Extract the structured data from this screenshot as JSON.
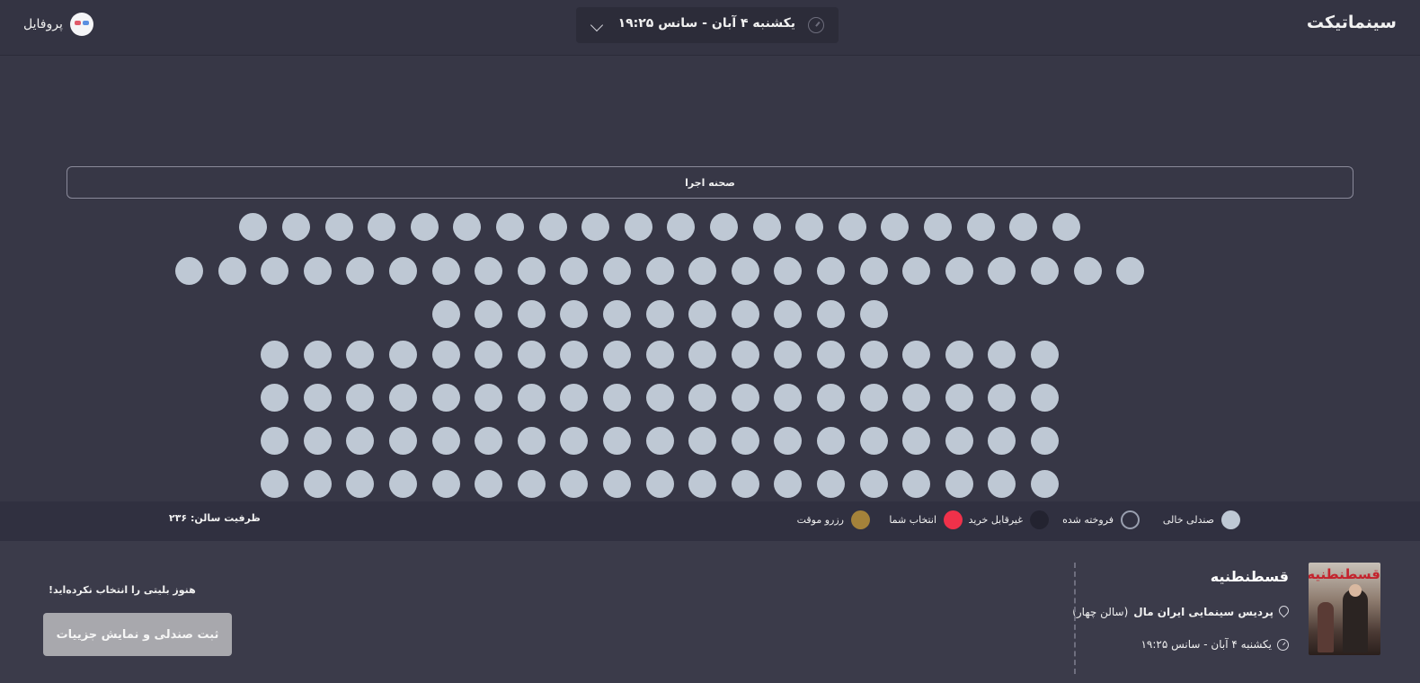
{
  "header": {
    "logo": "سینماتیکت",
    "showtime_label": "یکشنبه ۴ آبان - سانس ۱۹:۲۵",
    "profile_label": "پروفایل"
  },
  "stage": {
    "label": "صحنه اجرا"
  },
  "seat_map": {
    "rows": [
      {
        "row": 1,
        "seats": 20,
        "status": "empty"
      },
      {
        "row": 2,
        "seats": 23,
        "status": "empty"
      },
      {
        "row": 3,
        "seats": 11,
        "status": "empty"
      },
      {
        "row": 4,
        "seats": 19,
        "status": "empty"
      },
      {
        "row": 5,
        "seats": 19,
        "status": "empty"
      },
      {
        "row": 6,
        "seats": 19,
        "status": "empty"
      },
      {
        "row": 7,
        "seats": 19,
        "status": "empty"
      }
    ]
  },
  "legend": {
    "items": [
      {
        "label": "صندلی خالی",
        "color": "#bec8d4",
        "style": "fill"
      },
      {
        "label": "فروخته شده",
        "color": "#9aa0b0",
        "style": "outline"
      },
      {
        "label": "غیرقابل خرید",
        "color": "#232330",
        "style": "fill"
      },
      {
        "label": "انتخاب شما",
        "color": "#f0314a",
        "style": "fill"
      },
      {
        "label": "رزرو موقت",
        "color": "#a4823a",
        "style": "fill"
      }
    ],
    "capacity": "ظرفیت سالن: ۲۳۶"
  },
  "movie": {
    "title": "قسطنطنیه",
    "poster_title": "قسطنطنیه",
    "cinema": "پردیس سینمایی ایران مال",
    "hall": "(سالن چهار)",
    "datetime": "یکشنبه ۴ آبان - سانس ۱۹:۲۵"
  },
  "checkout": {
    "no_ticket_message": "هنوز بلیتی را انتخاب نکرده‌اید!",
    "submit_label": "ثبت صندلی و نمایش جزییات"
  },
  "colors": {
    "background": "#373746",
    "seat_empty": "#bec8d4",
    "button_disabled": "#a8a8ad"
  }
}
